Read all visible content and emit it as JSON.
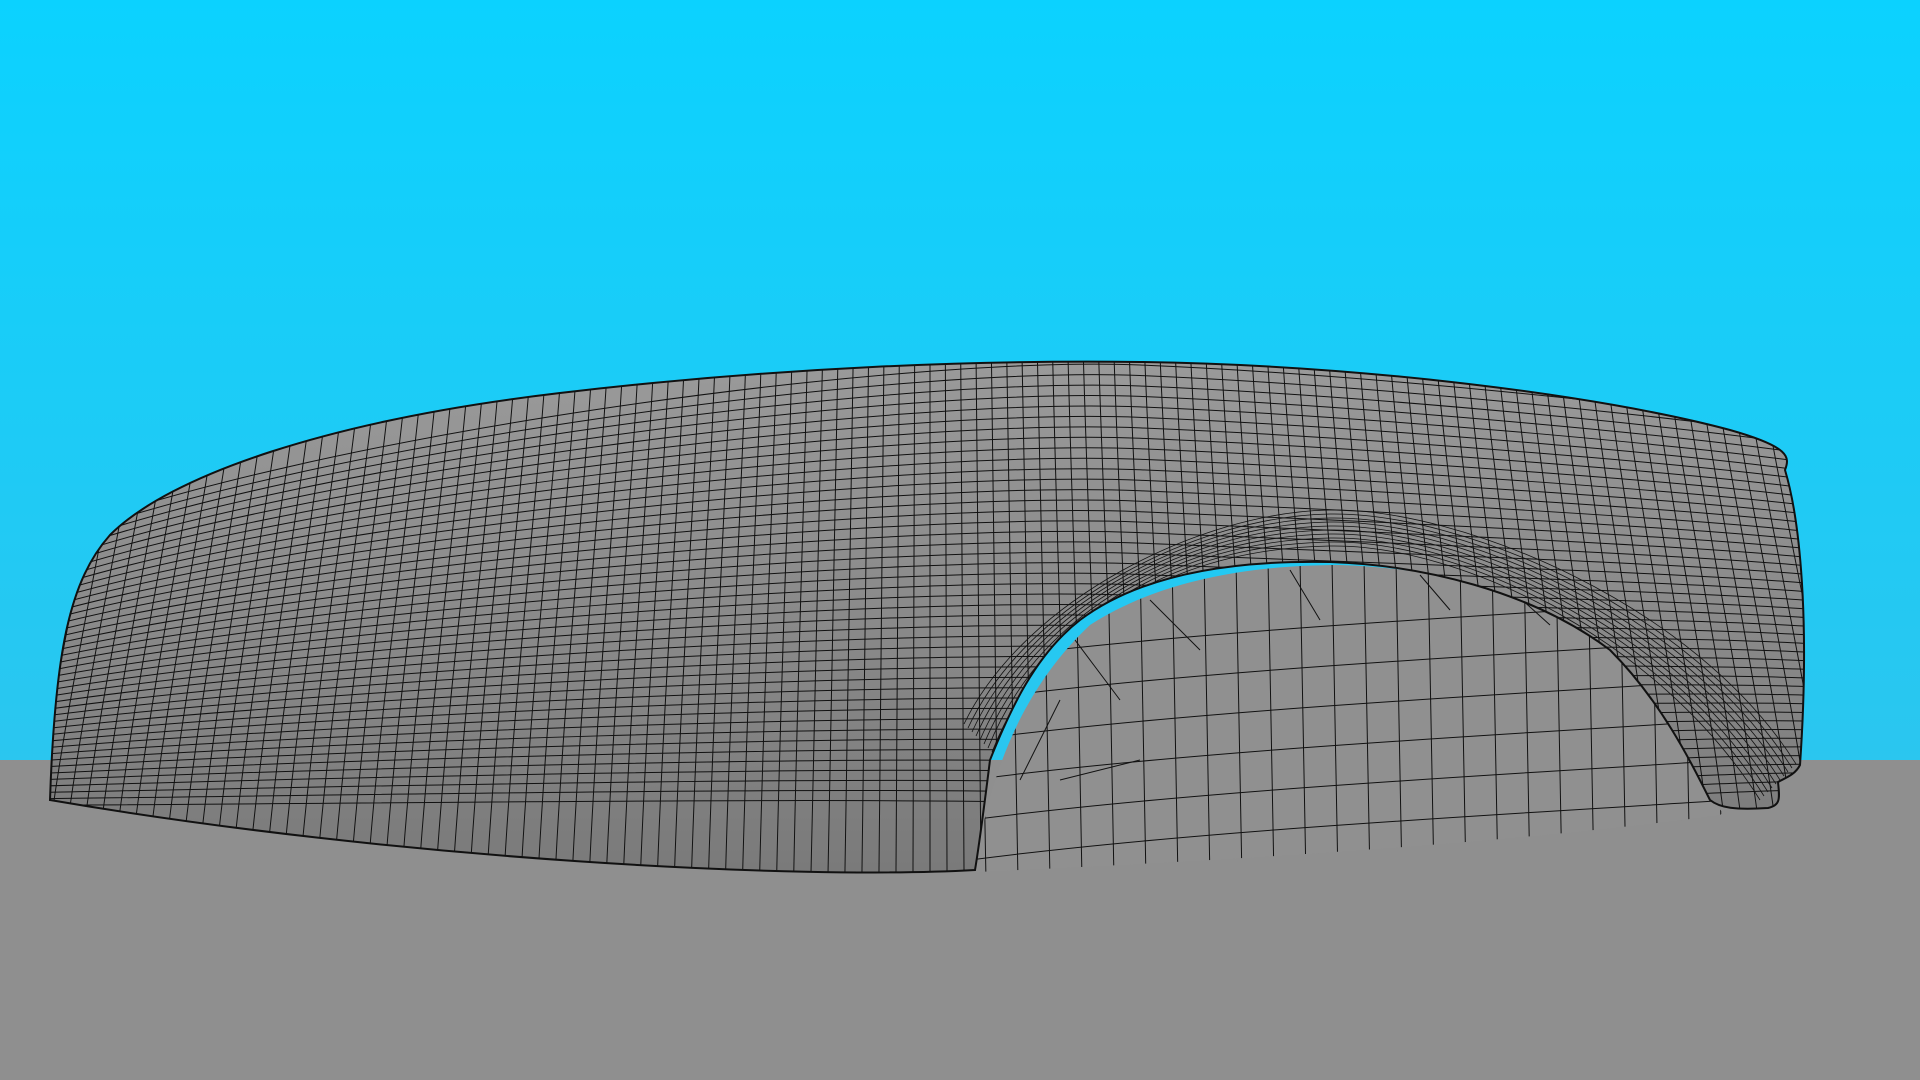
{
  "viewport": {
    "colors": {
      "sky_top": "#0bd2ff",
      "sky_horizon": "#2bc6ef",
      "ground": "#8f8f8f",
      "shell": "#8a8a8a",
      "shell_shadow": "#7a7a7a",
      "interior": "#909090",
      "wire": "#111111"
    }
  }
}
